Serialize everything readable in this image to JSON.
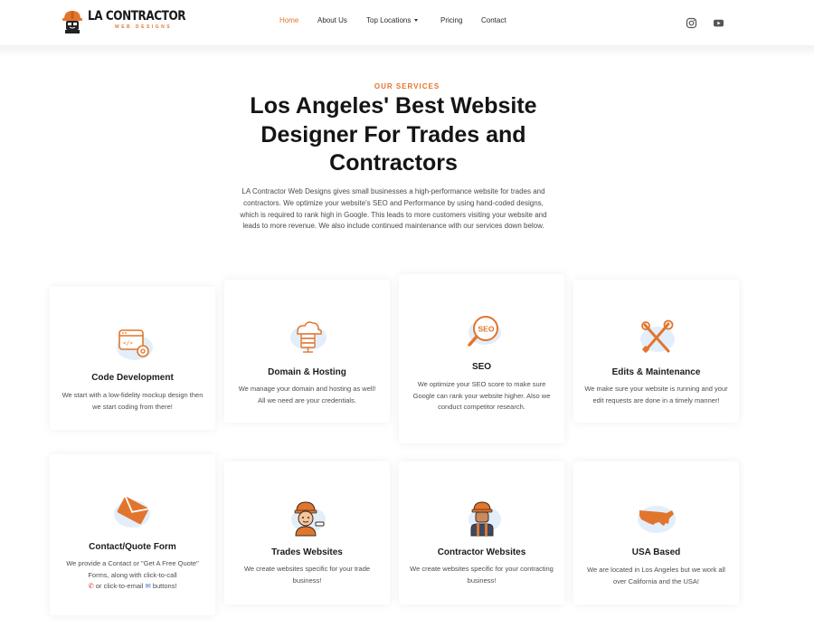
{
  "brand": {
    "name": "LA CONTRACTOR",
    "tagline": "WEB DESIGNS",
    "accent_color": "#e2752d"
  },
  "nav": {
    "items": [
      {
        "label": "Home",
        "active": true
      },
      {
        "label": "About Us"
      },
      {
        "label": "Top Locations",
        "dropdown": true
      },
      {
        "label": "Pricing"
      },
      {
        "label": "Contact"
      }
    ],
    "social": [
      "instagram-icon",
      "youtube-icon"
    ]
  },
  "hero": {
    "eyebrow": "OUR SERVICES",
    "title": "Los Angeles' Best Website Designer For Trades and Contractors",
    "intro": "LA Contractor Web Designs gives small businesses a high-performance website for trades and contractors. We optimize your website's SEO and Performance by using hand-coded designs, which is required to rank high in Google. This leads to more customers visiting your website and leads to more revenue. We also include continued maintenance with our services down below."
  },
  "services": [
    {
      "title": "Code Development",
      "icon": "code-gear-icon",
      "desc": "We start with a low-fidelity mockup design then we start coding from there!"
    },
    {
      "title": "Domain & Hosting",
      "icon": "cloud-server-icon",
      "desc": "We manage your domain and hosting as well! All we need are your credentials."
    },
    {
      "title": "SEO",
      "icon": "seo-magnifier-icon",
      "desc": "We optimize your SEO score to make sure Google can rank your website higher. Also we conduct competitor research."
    },
    {
      "title": "Edits & Maintenance",
      "icon": "wrench-screwdriver-icon",
      "desc": "We make sure your website is running and your edit requests are done in a timely manner!"
    },
    {
      "title": "Contact/Quote Form",
      "icon": "envelope-icon",
      "desc_before": "We provide a Contact or \"Get A Free Quote\" Forms, along with click-to-call",
      "desc_mid": "or click-to-email",
      "desc_after": "buttons!"
    },
    {
      "title": "Trades Websites",
      "icon": "tradesman-icon",
      "desc": "We create websites specific for your trade business!"
    },
    {
      "title": "Contractor Websites",
      "icon": "contractor-worker-icon",
      "desc": "We create websites specific for your contracting business!"
    },
    {
      "title": "USA Based",
      "icon": "usa-map-icon",
      "desc": "We are located in Los Angeles but we work all over California and the USA!"
    }
  ]
}
